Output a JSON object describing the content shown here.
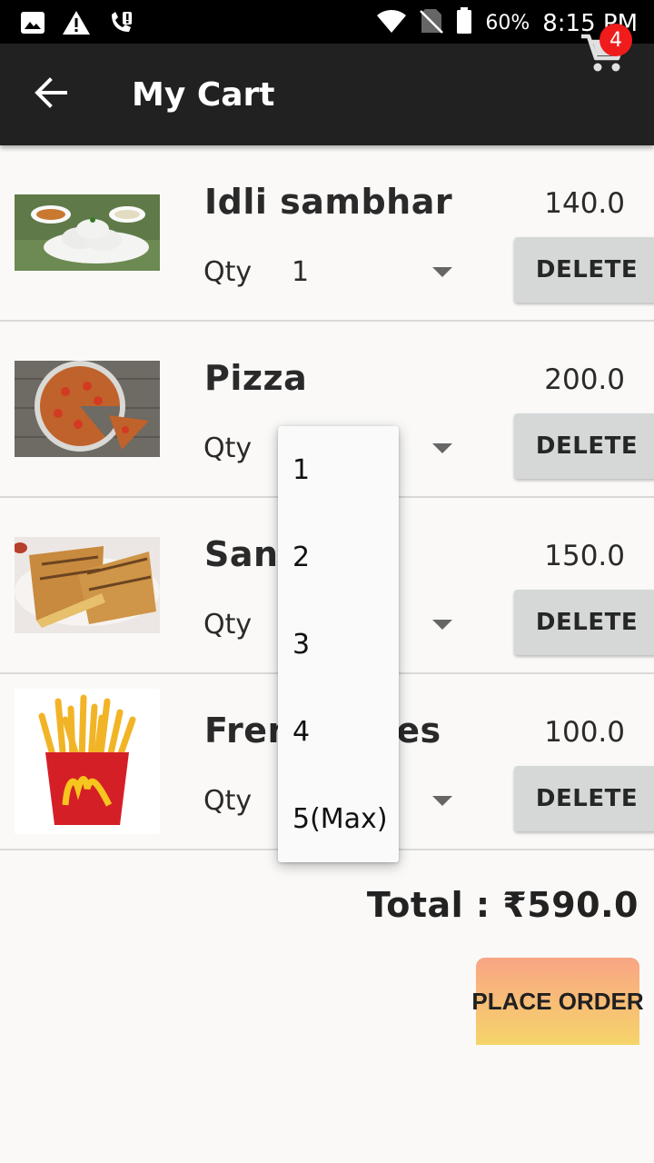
{
  "status_bar": {
    "battery": "60%",
    "time": "8:15 PM",
    "icons": [
      "image-icon",
      "warning-icon",
      "missed-call-icon",
      "wifi-icon",
      "no-sim-icon",
      "battery-icon"
    ]
  },
  "app_bar": {
    "title": "My Cart",
    "cart_count": "4",
    "icons": [
      "back-arrow-icon",
      "cart-icon"
    ]
  },
  "cart": {
    "qty_label": "Qty",
    "delete_label": "DELETE",
    "items": [
      {
        "name": "Idli sambhar",
        "price": "140.0",
        "qty": "1"
      },
      {
        "name": "Pizza",
        "price": "200.0",
        "qty": ""
      },
      {
        "name": "Sandwich",
        "price": "150.0",
        "qty": ""
      },
      {
        "name": "French fries",
        "price": "100.0",
        "qty": ""
      }
    ]
  },
  "summary": {
    "total": "Total : ₹590.0",
    "place_order_label": "PLACE ORDER"
  },
  "qty_dropdown": {
    "options": [
      "1",
      "2",
      "3",
      "4",
      "5(Max)"
    ]
  },
  "colors": {
    "app_bar": "#212121",
    "badge": "#f01c1c",
    "delete_button": "#d6d7d7",
    "place_order_top": "#f8a584",
    "place_order_bottom": "#f6d46a"
  }
}
